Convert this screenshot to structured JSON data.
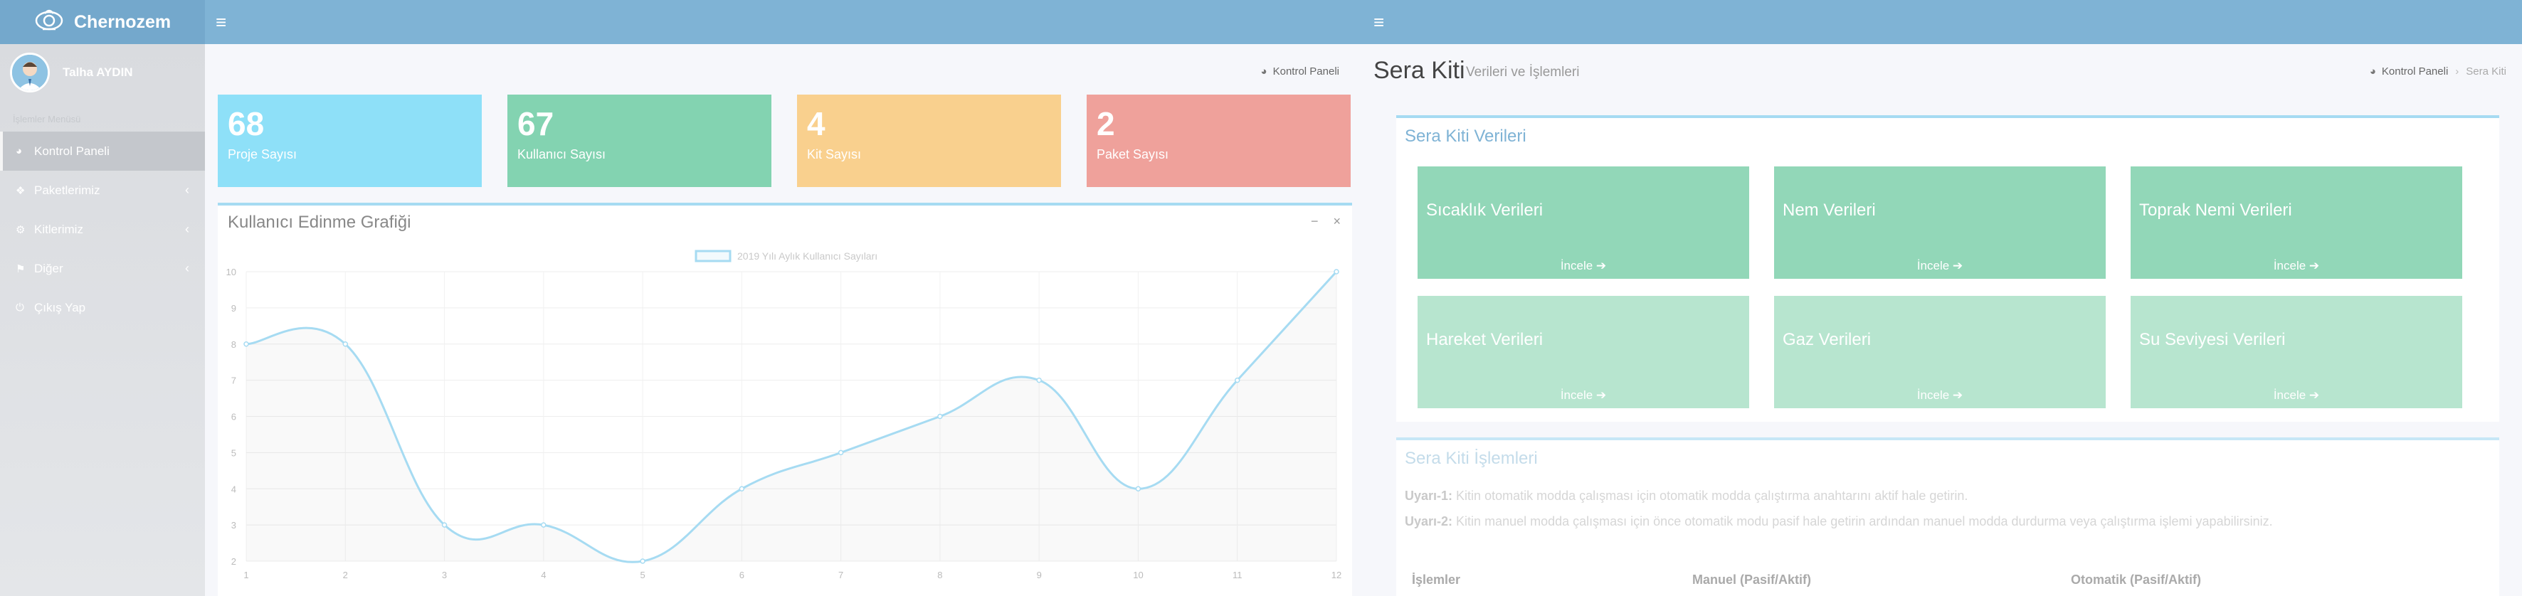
{
  "app": {
    "brand": "Chernozem"
  },
  "user": {
    "name": "Talha AYDIN"
  },
  "sidebar": {
    "section_title": "İşlemler Menüsü",
    "items": [
      {
        "label": "Kontrol Paneli",
        "icon": "dashboard-icon"
      },
      {
        "label": "Paketlerimiz",
        "icon": "cubes-icon"
      },
      {
        "label": "Kitlerimiz",
        "icon": "cogs-icon"
      },
      {
        "label": "Diğer",
        "icon": "flag-icon"
      },
      {
        "label": "Çıkış Yap",
        "icon": "power-icon"
      }
    ]
  },
  "dashboard": {
    "breadcrumb": "Kontrol Paneli",
    "stats": [
      {
        "value": "68",
        "label": "Proje Sayısı",
        "color": "#8ee0f8"
      },
      {
        "value": "67",
        "label": "Kullanıcı Sayısı",
        "color": "#83d3b1"
      },
      {
        "value": "4",
        "label": "Kit Sayısı",
        "color": "#f9d08e"
      },
      {
        "value": "2",
        "label": "Paket Sayısı",
        "color": "#efa19b"
      }
    ],
    "chart_title": "Kullanıcı Edinme Grafiği"
  },
  "chart_data": {
    "type": "line",
    "title": "",
    "legend": "2019 Yılı Aylık Kullanıcı Sayıları",
    "legend_position": "top",
    "x": [
      1,
      2,
      3,
      4,
      5,
      6,
      7,
      8,
      9,
      10,
      11,
      12
    ],
    "series": [
      {
        "name": "2019 Yılı Aylık Kullanıcı Sayıları",
        "values": [
          8,
          8,
          3,
          3,
          2,
          4,
          5,
          6,
          7,
          4,
          7,
          10
        ]
      }
    ],
    "ylim": [
      2,
      10
    ],
    "yticks": [
      2,
      3,
      4,
      5,
      6,
      7,
      8,
      9,
      10
    ],
    "grid": true,
    "color": "#a6dbf2"
  },
  "sera": {
    "page_title": "Sera Kiti",
    "page_subtitle": "Verileri ve İşlemleri",
    "breadcrumb_home": "Kontrol Paneli",
    "breadcrumb_current": "Sera Kiti",
    "data_panel_title": "Sera Kiti Verileri",
    "tiles": [
      {
        "title": "Sıcaklık Verileri",
        "more": "İncele"
      },
      {
        "title": "Nem Verileri",
        "more": "İncele"
      },
      {
        "title": "Toprak Nemi Verileri",
        "more": "İncele"
      },
      {
        "title": "Hareket Verileri",
        "more": "İncele"
      },
      {
        "title": "Gaz Verileri",
        "more": "İncele"
      },
      {
        "title": "Su Seviyesi Verileri",
        "more": "İncele"
      }
    ],
    "ops_panel_title": "Sera Kiti İşlemleri",
    "warnings": [
      {
        "label": "Uyarı-1:",
        "text": "Kitin otomatik modda çalışması için otomatik modda çalıştırma anahtarını aktif hale getirin."
      },
      {
        "label": "Uyarı-2:",
        "text": "Kitin manuel modda çalışması için önce otomatik modu pasif hale getirin ardından manuel modda durdurma veya çalıştırma işlemi yapabilirsiniz."
      }
    ],
    "table_headers": [
      "İşlemler",
      "Manuel (Pasif/Aktif)",
      "Otomatik (Pasif/Aktif)"
    ]
  }
}
